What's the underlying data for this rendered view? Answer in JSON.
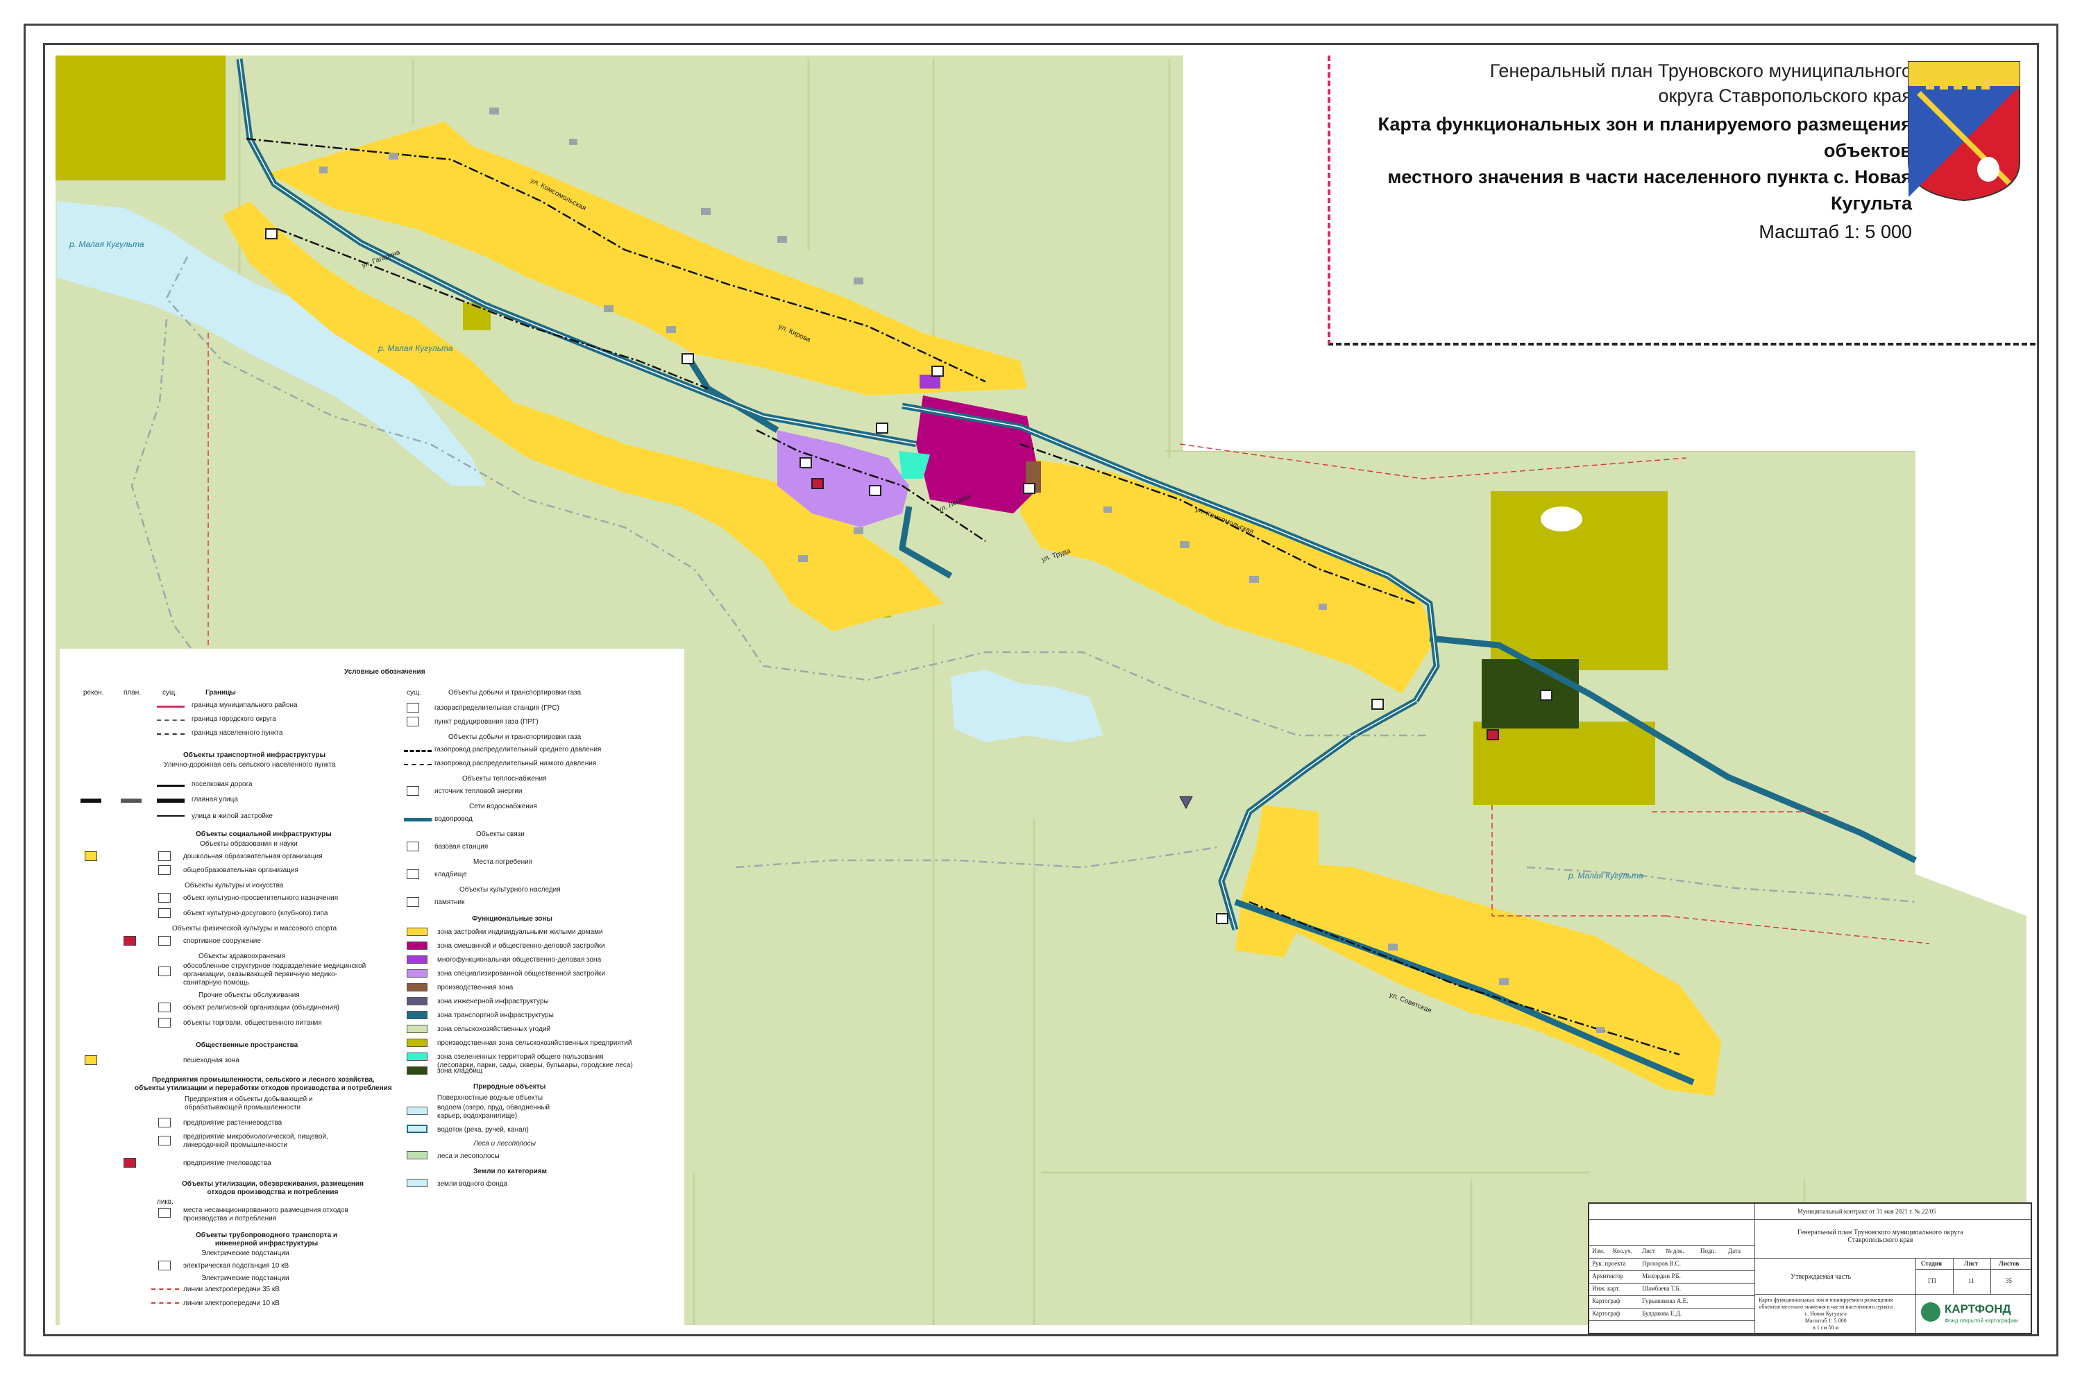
{
  "title": {
    "line1": "Генеральный план Труновского муниципального",
    "line2": "округа Ставропольского края",
    "line3": "Карта функциональных зон и планируемого размещения объектов",
    "line4": "местного значения в части населенного пункта с. Новая Кугульта",
    "scale": "Масштаб 1: 5 000"
  },
  "colors": {
    "agri": "#d5e3b4",
    "housing": "#ffd93a",
    "mixed": "#b4007d",
    "public": "#c38cf0",
    "water": "#cdeef6",
    "transport": "#1e6b88",
    "production_agri": "#bdbb00",
    "cemetery": "#2e4c12",
    "green_public": "#38f2cc",
    "production": "#8a5a3c"
  },
  "map_labels": {
    "river1": "р. Малая Кугульта",
    "river2": "р. Малая Кугульта",
    "river3": "р. Малая Кугульта",
    "street1": "ул. Кирова",
    "street2": "ул. Комсомольская",
    "street3": "ул. Советская",
    "street4": "ул. Труда",
    "street5": "ул. Гагарина",
    "street6": "ул. Ленина"
  },
  "legend": {
    "title": "Условные обозначения",
    "col_headers": {
      "rekon": "рекон.",
      "plan": "план.",
      "sush": "сущ.",
      "borders": "Границы"
    },
    "borders": [
      "граница муниципального района",
      "граница городского округа",
      "граница населенного пункта"
    ],
    "transport_header": "Объекты транспортной инфраструктуры",
    "transport_sub": "Улично-дорожная сеть сельского населенного пункта",
    "transport": [
      "поселковая дорога",
      "главная улица",
      "улица в жилой застройке"
    ],
    "social_header": "Объекты социальной инфраструктуры",
    "edu_header": "Объекты образования и науки",
    "edu": [
      "дошкольная образовательная организация",
      "общеобразовательная организация"
    ],
    "culture_header": "Объекты культуры и искусства",
    "culture": [
      "объект культурно-просветительного назначения",
      "объект культурно-досугового (клубного) типа"
    ],
    "sport_header": "Объекты физической культуры и массового спорта",
    "sport": [
      "спортивное сооружение"
    ],
    "health_header": "Объекты здравоохранения",
    "health": [
      "обособленное структурное подразделение медицинской\nорганизации, оказывающей первичную медико-\nсанитарную помощь"
    ],
    "other_header": "Прочие объекты обслуживания",
    "other": [
      "объект религиозной организации (объединения)",
      "объекты торговли, общественного питания"
    ],
    "public_spaces_header": "Общественные пространства",
    "public_spaces": [
      "пешеходная зона"
    ],
    "industry_header": "Предприятия промышленности, сельского и лесного хозяйства,\nобъекты утилизации и переработки отходов производства и потребления",
    "industry_sub": "Предприятия и объекты добывающей и\nобрабатывающей промышленности",
    "industry": [
      "предприятие растениеводства",
      "предприятие микробиологической, пищевой,\nликеродочной промышленности",
      "предприятие пчеловодства"
    ],
    "waste_header": "Объекты утилизации, обезвреживания, размещения\nотходов производства и потребления",
    "waste_likv": "ликв.",
    "waste": [
      "места несанкционированного размещения отходов\nпроизводства и потребления"
    ],
    "pipeline_header": "Объекты трубопроводного транспорта и\nинженерной инфраструктуры",
    "substations_header": "Электрические подстанции",
    "substations": [
      "электрическая подстанция 10 кВ"
    ],
    "lines_header": "Электрические подстанции",
    "lines": [
      "линии электропередачи 35 кВ",
      "линии электропередачи 10 кВ"
    ],
    "col2_sush": "сущ.",
    "gas_header": "Объекты добычи и транспортировки газа",
    "gas": [
      "газораспределительная станция (ГРС)",
      "пункт редуцирования газа (ПРГ)"
    ],
    "gas2_header": "Объекты добычи и транспортировки газа",
    "gas2": [
      "газопровод распределительный среднего давления",
      "газопровод распределительный низкого давления"
    ],
    "heat_header": "Объекты теплоснабжения",
    "heat": [
      "источник тепловой энергии"
    ],
    "water_header": "Сети водоснабжения",
    "water": [
      "водопровод"
    ],
    "comm_header": "Объекты связи",
    "comm": [
      "базовая станция"
    ],
    "burial_header": "Места погребения",
    "burial": [
      "кладбище"
    ],
    "heritage_header": "Объекты культурного наследия",
    "heritage": [
      "памятник"
    ],
    "zones_header": "Функциональные зоны",
    "zones": [
      {
        "label": "зона застройки индивидуальными жилыми домами",
        "color": "#ffd93a"
      },
      {
        "label": "зона смешанной и общественно-деловой застройки",
        "color": "#b4007d"
      },
      {
        "label": "многофункциональная общественно-деловая зона",
        "color": "#a23ad6"
      },
      {
        "label": "зона специализированной общественной застройки",
        "color": "#c38cf0"
      },
      {
        "label": "производственная зона",
        "color": "#8a5a3c"
      },
      {
        "label": "зона инженерной инфраструктуры",
        "color": "#5d5a82"
      },
      {
        "label": "зона транспортной инфраструктуры",
        "color": "#1e6b88"
      },
      {
        "label": "зона сельскохозяйственных угодий",
        "color": "#d5e3b4"
      },
      {
        "label": "производственная зона сельскохозяйственных предприятий",
        "color": "#bdbb00"
      },
      {
        "label": "зона озелененных территорий общего пользования\n(лесопарки, парки, сады, скверы, бульвары, городские леса)",
        "color": "#38f2cc"
      },
      {
        "label": "зона кладбищ",
        "color": "#2e4c12"
      }
    ],
    "natural_header": "Природные объекты",
    "natural_sub": "Поверхностные водные объекты",
    "natural": [
      {
        "label": "водоем (озеро, пруд, обводненный\nкарьер, водохранилище)",
        "color": "#cdeef6"
      },
      {
        "label": "водоток (река, ручей, канал)",
        "color": "#cdeef6"
      }
    ],
    "forest_header": "Леса и лесополосы",
    "forest": [
      {
        "label": "леса и лесополосы",
        "color": "#bfe0b0"
      }
    ],
    "landcat_header": "Земли по категориям",
    "landcat": [
      {
        "label": "земли водного фонда",
        "color": "#cdeef6"
      }
    ]
  },
  "stamp": {
    "contract": "Муниципальный контракт  от 31 мая 2021 г. № 22/05",
    "heads": [
      "Изм.",
      "Кол.уч.",
      "Лист",
      "№ док.",
      "Подп.",
      "Дата"
    ],
    "staff": [
      {
        "role": "Рук. проекта",
        "name": "Прохоров В.С."
      },
      {
        "role": "Архитектор",
        "name": "Михордин Р.Б."
      },
      {
        "role": "Инж. карт.",
        "name": "Шамбаева Т.Б."
      },
      {
        "role": "Картограф",
        "name": "Гурьевикова А.Е."
      },
      {
        "role": "Картограф",
        "name": "Булдакова Е.Д."
      }
    ],
    "project": "Генеральный план Труновского муниципального округа\nСтавропольского края",
    "part": "Утверждаемая часть",
    "stage_h": "Стадия",
    "sheet_h": "Лист",
    "sheets_h": "Листов",
    "stage": "ГП",
    "sheet": "11",
    "sheets": "35",
    "desc": "Карта функциональных зон и планируемого размещения\nобъектов местного значения в части населенного пункта\nс. Новая Кугульта\nМасштаб 1: 5 000\nв 1 см 50 м",
    "brand": "КАРТФОНД",
    "brand_sub": "Фонд открытой картографии"
  }
}
